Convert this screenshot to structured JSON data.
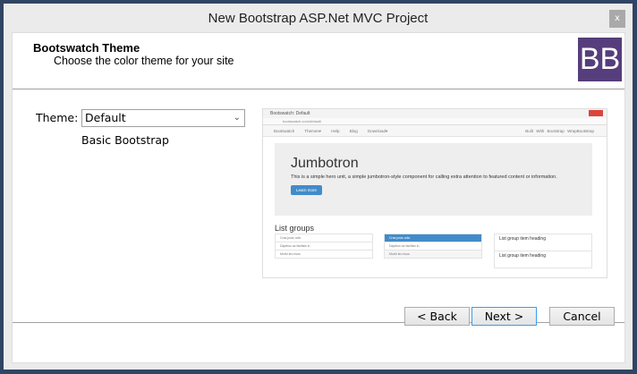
{
  "window": {
    "title": "New Bootstrap ASP.Net MVC Project",
    "close_label": "x"
  },
  "header": {
    "title": "Bootswatch Theme",
    "subtitle": "Choose the color theme for your site",
    "logo_text": "BB"
  },
  "form": {
    "theme_label": "Theme:",
    "theme_value": "Default",
    "theme_description": "Basic Bootstrap"
  },
  "preview": {
    "tab": "Bootswatch: Default",
    "address": "bootswatch.com/default/",
    "nav": "Bootswatch Themes▾ Help Blog Download▾",
    "nav_right": "Built With Bootstrap  WrapBootstrap",
    "jumbotron_title": "Jumbotron",
    "jumbotron_text": "This is a simple hero unit, a simple jumbotron-style component for calling extra attention to featured content or information.",
    "jumbotron_button": "Learn more",
    "list_title": "List groups",
    "list_items": [
      "Cras justo odio",
      "Dapibus ac facilisis in",
      "Morbi leo risus"
    ],
    "list_heading": "List group item heading"
  },
  "buttons": {
    "back": "< Back",
    "next": "Next >",
    "cancel": "Cancel"
  }
}
